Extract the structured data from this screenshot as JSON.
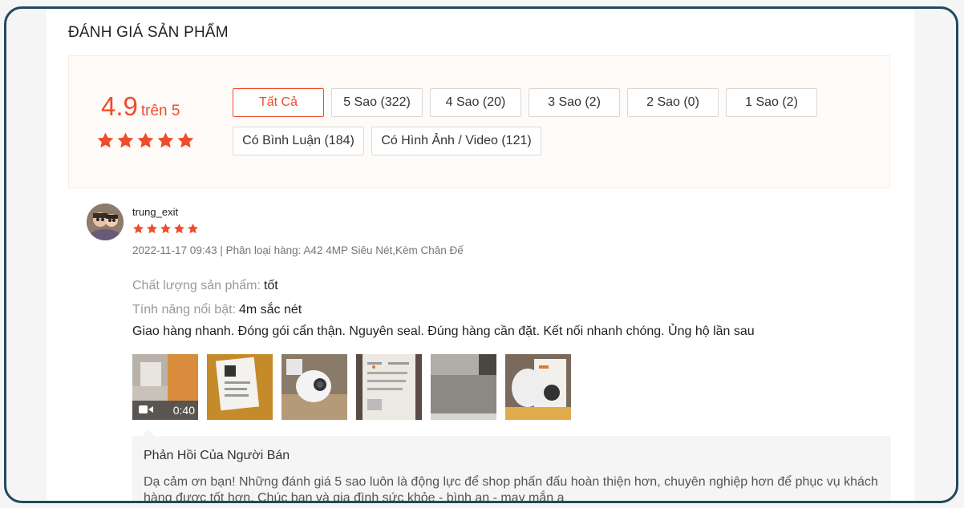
{
  "section_title": "ĐÁNH GIÁ SẢN PHẨM",
  "overview": {
    "score": "4.9",
    "score_suffix": "trên 5",
    "rating_stars": 5,
    "filters": [
      "Tất Cả",
      "5 Sao (322)",
      "4 Sao (20)",
      "3 Sao (2)",
      "2 Sao (0)",
      "1 Sao (2)",
      "Có Bình Luận (184)",
      "Có Hình Ảnh / Video (121)"
    ],
    "active_filter_index": 0
  },
  "review": {
    "username": "trung_exit",
    "rating_stars": 5,
    "meta": "2022-11-17 09:43 | Phân loại hàng: A42 4MP Siêu Nét,Kèm Chân Đế",
    "attributes": [
      {
        "label": "Chất lượng sản phẩm:",
        "value": "tốt"
      },
      {
        "label": "Tính năng nổi bật:",
        "value": "4m sắc nét"
      }
    ],
    "comment": "Giao hàng nhanh. Đóng gói cẩn thận. Nguyên seal. Đúng hàng cần đặt. Kết nối nhanh chóng. Ủng hộ lần sau",
    "video_duration": "0:40",
    "media_count": 6,
    "reply": {
      "title": "Phản Hồi Của Người Bán",
      "body": "Dạ cảm ơn bạn! Những đánh giá 5 sao luôn là động lực để shop phấn đấu hoàn thiện hơn, chuyên nghiệp hơn để phục vụ khách hàng được tốt hơn. Chúc bạn và gia đình sức khỏe - bình an - may mắn ạ"
    }
  },
  "colors": {
    "accent": "#ee4d2d",
    "frame_border": "#1f4a5c",
    "overview_bg": "#fffbf8"
  }
}
